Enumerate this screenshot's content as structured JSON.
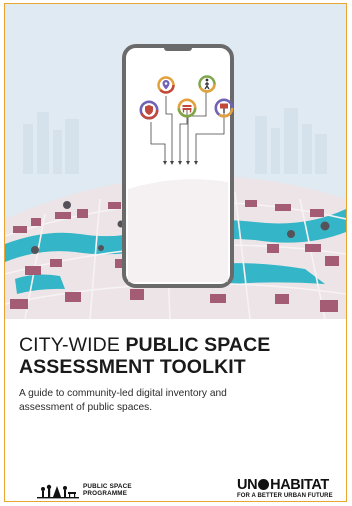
{
  "title": {
    "light": "CITY-WIDE ",
    "bold_a": "PUBLIC SPACE",
    "bold_b": "ASSESSMENT TOOLKIT"
  },
  "subtitle": {
    "line1": "A guide to community-led digital inventory and",
    "line2": "assessment of public spaces."
  },
  "logos": {
    "psp_line1": "PUBLIC SPACE",
    "psp_line2": "PROGRAMME",
    "un_name_a": "UN",
    "un_name_b": "HABITAT",
    "un_tagline": "FOR A BETTER URBAN FUTURE"
  },
  "colors": {
    "page_border": "#eaa531",
    "sky": "#dfeaf3",
    "map_base": "#ece4e6",
    "blocks": "#a45b74",
    "water": "#34b6c8",
    "phone_frame": "#6a6a6a",
    "icon_red": "#c2483c",
    "icon_orange": "#e3a13b",
    "icon_purple": "#6e63b5",
    "icon_green": "#7fa64a"
  },
  "icons": [
    "location-pin-icon",
    "person-walking-icon",
    "shield-icon",
    "bench-icon",
    "sign-icon"
  ]
}
